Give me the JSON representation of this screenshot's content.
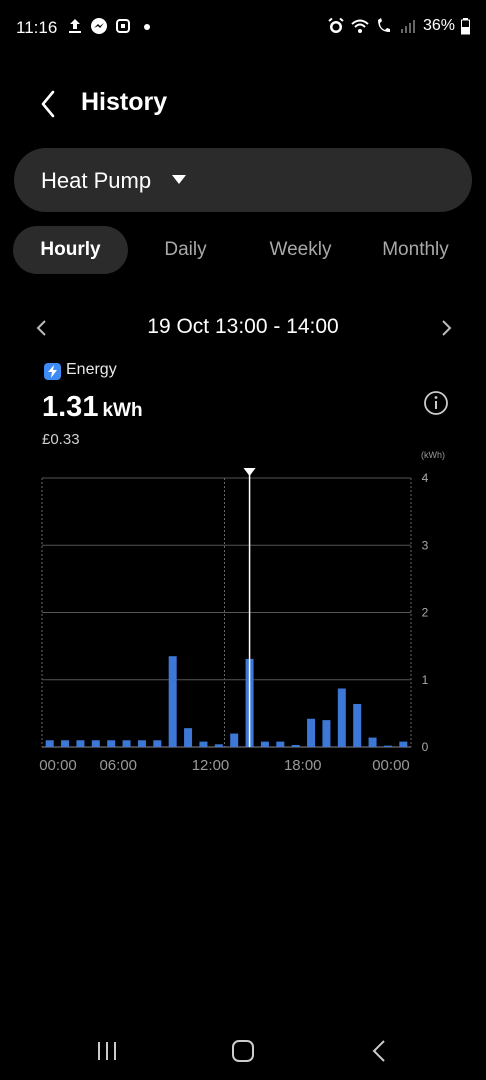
{
  "status_bar": {
    "time": "11:16",
    "battery": "36%",
    "left_icons": [
      "upload-icon",
      "messenger-icon",
      "app-icon",
      "dot-icon"
    ],
    "right_icons": [
      "alarm-icon",
      "wifi-icon",
      "wifi-call-icon",
      "signal-icon",
      "battery-icon"
    ]
  },
  "header": {
    "title": "History"
  },
  "device_selector": {
    "value": "Heat Pump"
  },
  "tabs": [
    {
      "label": "Hourly",
      "active": true
    },
    {
      "label": "Daily",
      "active": false
    },
    {
      "label": "Weekly",
      "active": false
    },
    {
      "label": "Monthly",
      "active": false
    }
  ],
  "date_nav": {
    "label": "19 Oct 13:00 - 14:00"
  },
  "summary": {
    "metric_label": "Energy",
    "value": "1.31",
    "unit": "kWh",
    "cost": "£0.33"
  },
  "chart_data": {
    "type": "bar",
    "unit_label": "(kWh)",
    "ylim": [
      0,
      4
    ],
    "y_ticks": [
      "0",
      "1",
      "2",
      "3",
      "4"
    ],
    "x_tick_labels": [
      "00:00",
      "06:00",
      "12:00",
      "18:00",
      "00:00"
    ],
    "hours": [
      0,
      1,
      2,
      3,
      4,
      5,
      6,
      7,
      8,
      9,
      10,
      11,
      12,
      13,
      14,
      15,
      16,
      17,
      18,
      19,
      20,
      21,
      22,
      23
    ],
    "values": [
      0.1,
      0.1,
      0.1,
      0.1,
      0.1,
      0.1,
      0.1,
      0.1,
      1.35,
      0.28,
      0.08,
      0.04,
      0.2,
      1.31,
      0.08,
      0.08,
      0.03,
      0.42,
      0.4,
      0.87,
      0.64,
      0.14,
      0.02,
      0.08
    ],
    "selected_hour": 13,
    "accent_color": "#3e78d6",
    "grid": true
  },
  "nav_bar": {
    "buttons": [
      "recents-button",
      "home-button",
      "back-button"
    ]
  }
}
